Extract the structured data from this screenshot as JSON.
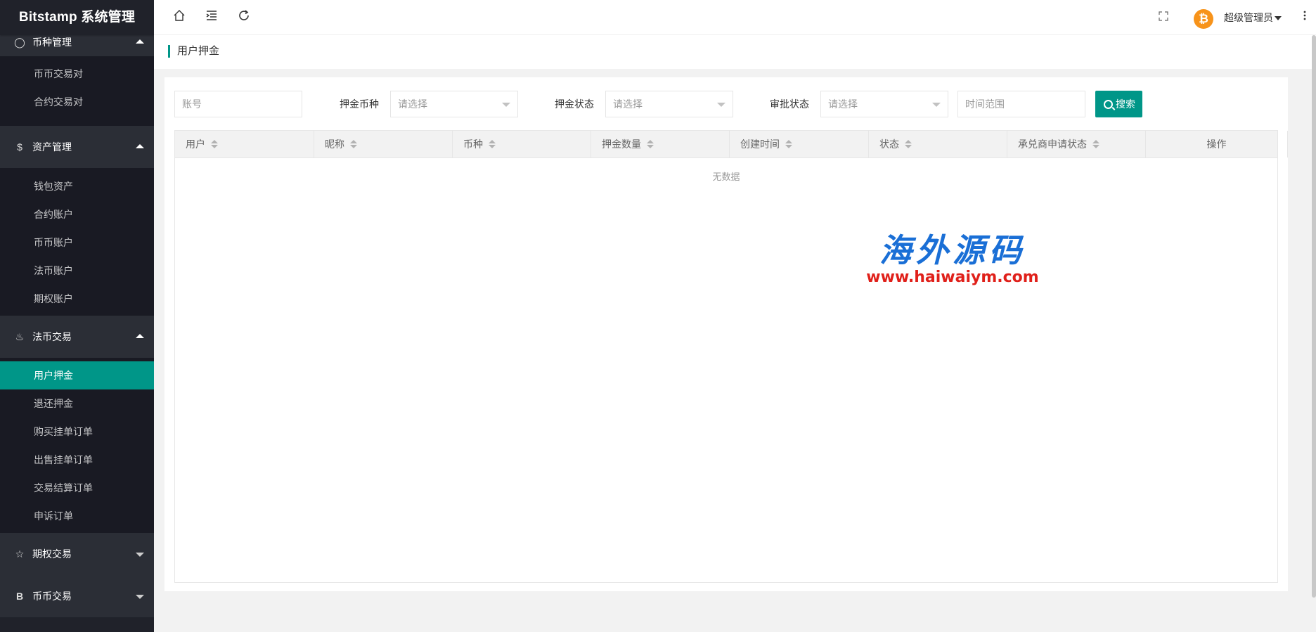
{
  "app": {
    "title": "Bitstamp 系统管理"
  },
  "sidebar": {
    "groups": [
      {
        "label": "币种管理",
        "icon": "coins-icon",
        "expanded": true,
        "items": [
          "币币交易对",
          "合约交易对"
        ]
      },
      {
        "label": "资产管理",
        "icon": "dollar-circle-icon",
        "expanded": true,
        "items": [
          "钱包资产",
          "合约账户",
          "币币账户",
          "法币账户",
          "期权账户"
        ]
      },
      {
        "label": "法币交易",
        "icon": "fire-icon",
        "expanded": true,
        "items": [
          "用户押金",
          "退还押金",
          "购买挂单订单",
          "出售挂单订单",
          "交易结算订单",
          "申诉订单"
        ]
      },
      {
        "label": "期权交易",
        "icon": "star-icon",
        "expanded": false,
        "items": []
      },
      {
        "label": "币币交易",
        "icon": "b-letter-icon",
        "expanded": false,
        "items": []
      }
    ],
    "active_item": "用户押金"
  },
  "header": {
    "icons": [
      "home-icon",
      "menu-fold-icon",
      "refresh-icon",
      "fullscreen-icon",
      "more-icon"
    ],
    "user_name": "超级管理员",
    "avatar_symbol": "₿"
  },
  "tab": {
    "title": "用户押金"
  },
  "filters": {
    "account_placeholder": "账号",
    "currency_label": "押金币种",
    "currency_value": "请选择",
    "deposit_status_label": "押金状态",
    "deposit_status_value": "请选择",
    "approval_status_label": "审批状态",
    "approval_status_value": "请选择",
    "time_range_placeholder": "时间范围",
    "search_label": "搜索"
  },
  "table": {
    "columns": [
      "用户",
      "昵称",
      "币种",
      "押金数量",
      "创建时间",
      "状态",
      "承兑商申请状态",
      "操作"
    ],
    "rows": [],
    "empty_text": "无数据"
  },
  "watermark": {
    "cn": "海外源码",
    "url": "www.haiwaiym.com"
  },
  "colors": {
    "primary": "#009688",
    "sidebar_bg": "#20222a",
    "watermark_blue": "#1a6fd6",
    "watermark_red": "#e0201a"
  }
}
